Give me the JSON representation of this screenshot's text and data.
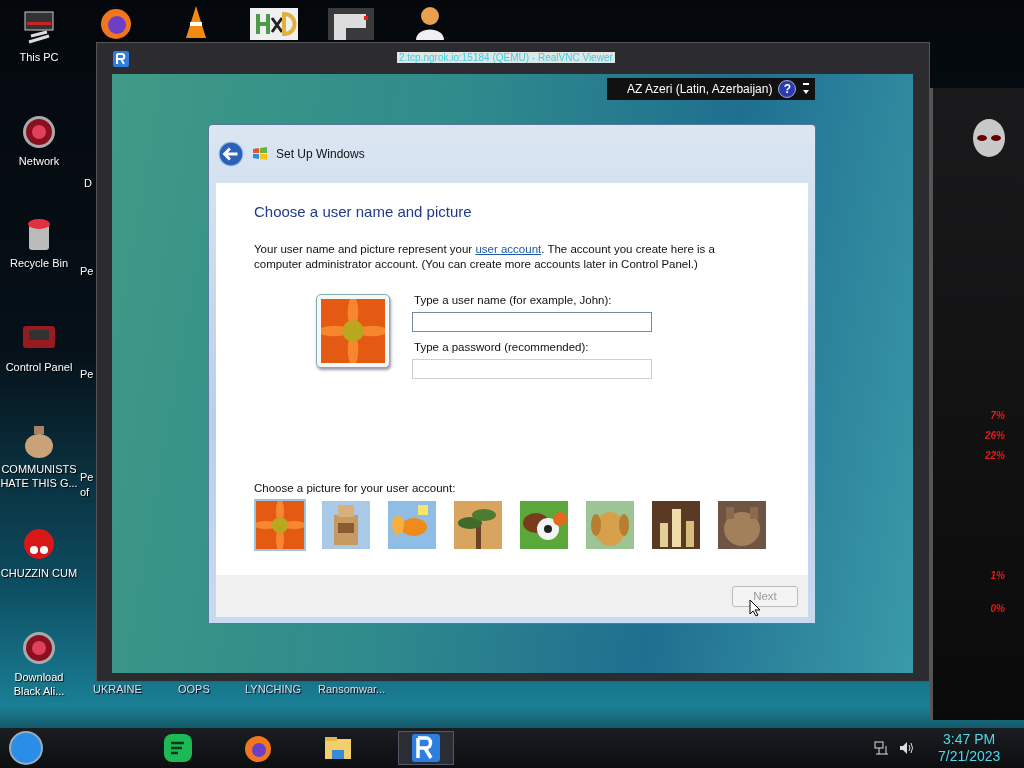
{
  "desktop": {
    "icons": [
      {
        "label": "This PC"
      },
      {
        "label": "Network"
      },
      {
        "label": "Recycle Bin"
      },
      {
        "label": "Control Panel"
      },
      {
        "label": "COMMUNISTS HATE THIS G..."
      },
      {
        "label": "CHUZZIN CUM"
      },
      {
        "label": "Download Black Ali..."
      }
    ],
    "partial_labels": [
      "D",
      "Pe",
      "Pe",
      "Pe",
      "of"
    ],
    "bottom_labels": [
      "UKRAINE",
      "OOPS",
      "LYNCHING",
      "Ransomwar..."
    ]
  },
  "gadget": {
    "readings": [
      "7%",
      "26%",
      "22%",
      "1%",
      "0%"
    ]
  },
  "vnc_window": {
    "title": "2.tcp.ngrok.io:15184 (QEMU) - RealVNC Viewer",
    "language_bar": {
      "label": "AZ Azeri (Latin, Azerbaijan)",
      "help": "?"
    },
    "setup": {
      "title": "Set Up Windows",
      "heading": "Choose a user name and picture",
      "intro_before": "Your user name and picture represent your ",
      "intro_link": "user account",
      "intro_after": ". The account you create here is a computer administrator account. (You can create more accounts later in Control Panel.)",
      "fields": [
        {
          "label": "Type a user name (for example, John):",
          "focused": true
        },
        {
          "label": "Type a password (recommended):",
          "focused": false
        }
      ],
      "pictures_label": "Choose a picture for your user account:",
      "pictures": [
        {
          "kind": "picture",
          "selected": true
        },
        {
          "kind": "picture",
          "selected": false
        },
        {
          "kind": "picture",
          "selected": false
        },
        {
          "kind": "picture",
          "selected": false
        },
        {
          "kind": "picture",
          "selected": false
        },
        {
          "kind": "picture",
          "selected": false
        },
        {
          "kind": "picture",
          "selected": false
        },
        {
          "kind": "picture",
          "selected": false
        }
      ],
      "next_button": {
        "label": "Next",
        "disabled": true
      }
    }
  },
  "taskbar": {
    "items": [
      {
        "selected": false
      },
      {
        "selected": false
      },
      {
        "selected": false
      },
      {
        "selected": true
      }
    ],
    "clock": {
      "time": "3:47 PM",
      "date": "7/21/2023"
    }
  }
}
